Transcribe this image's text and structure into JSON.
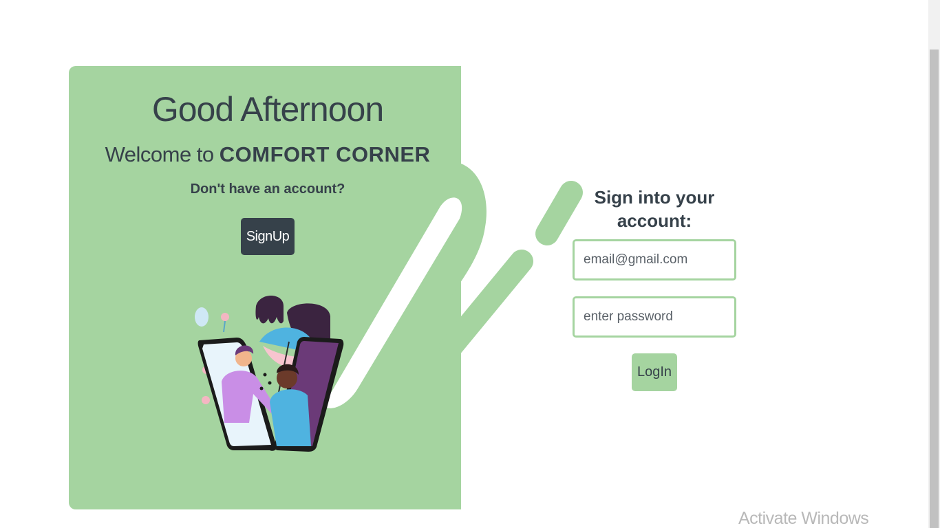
{
  "welcome_panel": {
    "greeting": "Good Afternoon",
    "welcome_prefix": "Welcome to ",
    "brand_name": "COMFORT CORNER",
    "account_question": "Don't have an account?",
    "signup_label": "SignUp"
  },
  "signin_form": {
    "title": "Sign into your account:",
    "email_placeholder": "email@gmail.com",
    "password_placeholder": "enter password",
    "login_label": "LogIn"
  },
  "watermark": "Activate Windows",
  "colors": {
    "panel_green": "#a5d4a0",
    "dark_slate": "#36414a",
    "white": "#ffffff"
  }
}
